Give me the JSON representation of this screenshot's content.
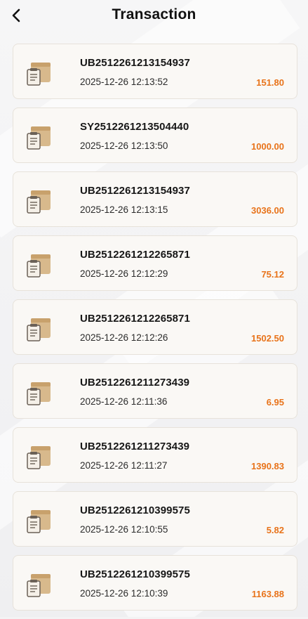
{
  "header": {
    "title": "Transaction",
    "back_icon": "chevron-left-icon"
  },
  "colors": {
    "amount": "#e8731a",
    "card_background": "#faf8f5",
    "icon_box": "#d8b98c"
  },
  "transactions": [
    {
      "id": "UB2512261213154937",
      "time": "2025-12-26 12:13:52",
      "amount": "151.80",
      "icon": "package-clipboard-icon"
    },
    {
      "id": "SY2512261213504440",
      "time": "2025-12-26 12:13:50",
      "amount": "1000.00",
      "icon": "package-clipboard-icon"
    },
    {
      "id": "UB2512261213154937",
      "time": "2025-12-26 12:13:15",
      "amount": "3036.00",
      "icon": "package-clipboard-icon"
    },
    {
      "id": "UB2512261212265871",
      "time": "2025-12-26 12:12:29",
      "amount": "75.12",
      "icon": "package-clipboard-icon"
    },
    {
      "id": "UB2512261212265871",
      "time": "2025-12-26 12:12:26",
      "amount": "1502.50",
      "icon": "package-clipboard-icon"
    },
    {
      "id": "UB2512261211273439",
      "time": "2025-12-26 12:11:36",
      "amount": "6.95",
      "icon": "package-clipboard-icon"
    },
    {
      "id": "UB2512261211273439",
      "time": "2025-12-26 12:11:27",
      "amount": "1390.83",
      "icon": "package-clipboard-icon"
    },
    {
      "id": "UB2512261210399575",
      "time": "2025-12-26 12:10:55",
      "amount": "5.82",
      "icon": "package-clipboard-icon"
    },
    {
      "id": "UB2512261210399575",
      "time": "2025-12-26 12:10:39",
      "amount": "1163.88",
      "icon": "package-clipboard-icon"
    }
  ]
}
